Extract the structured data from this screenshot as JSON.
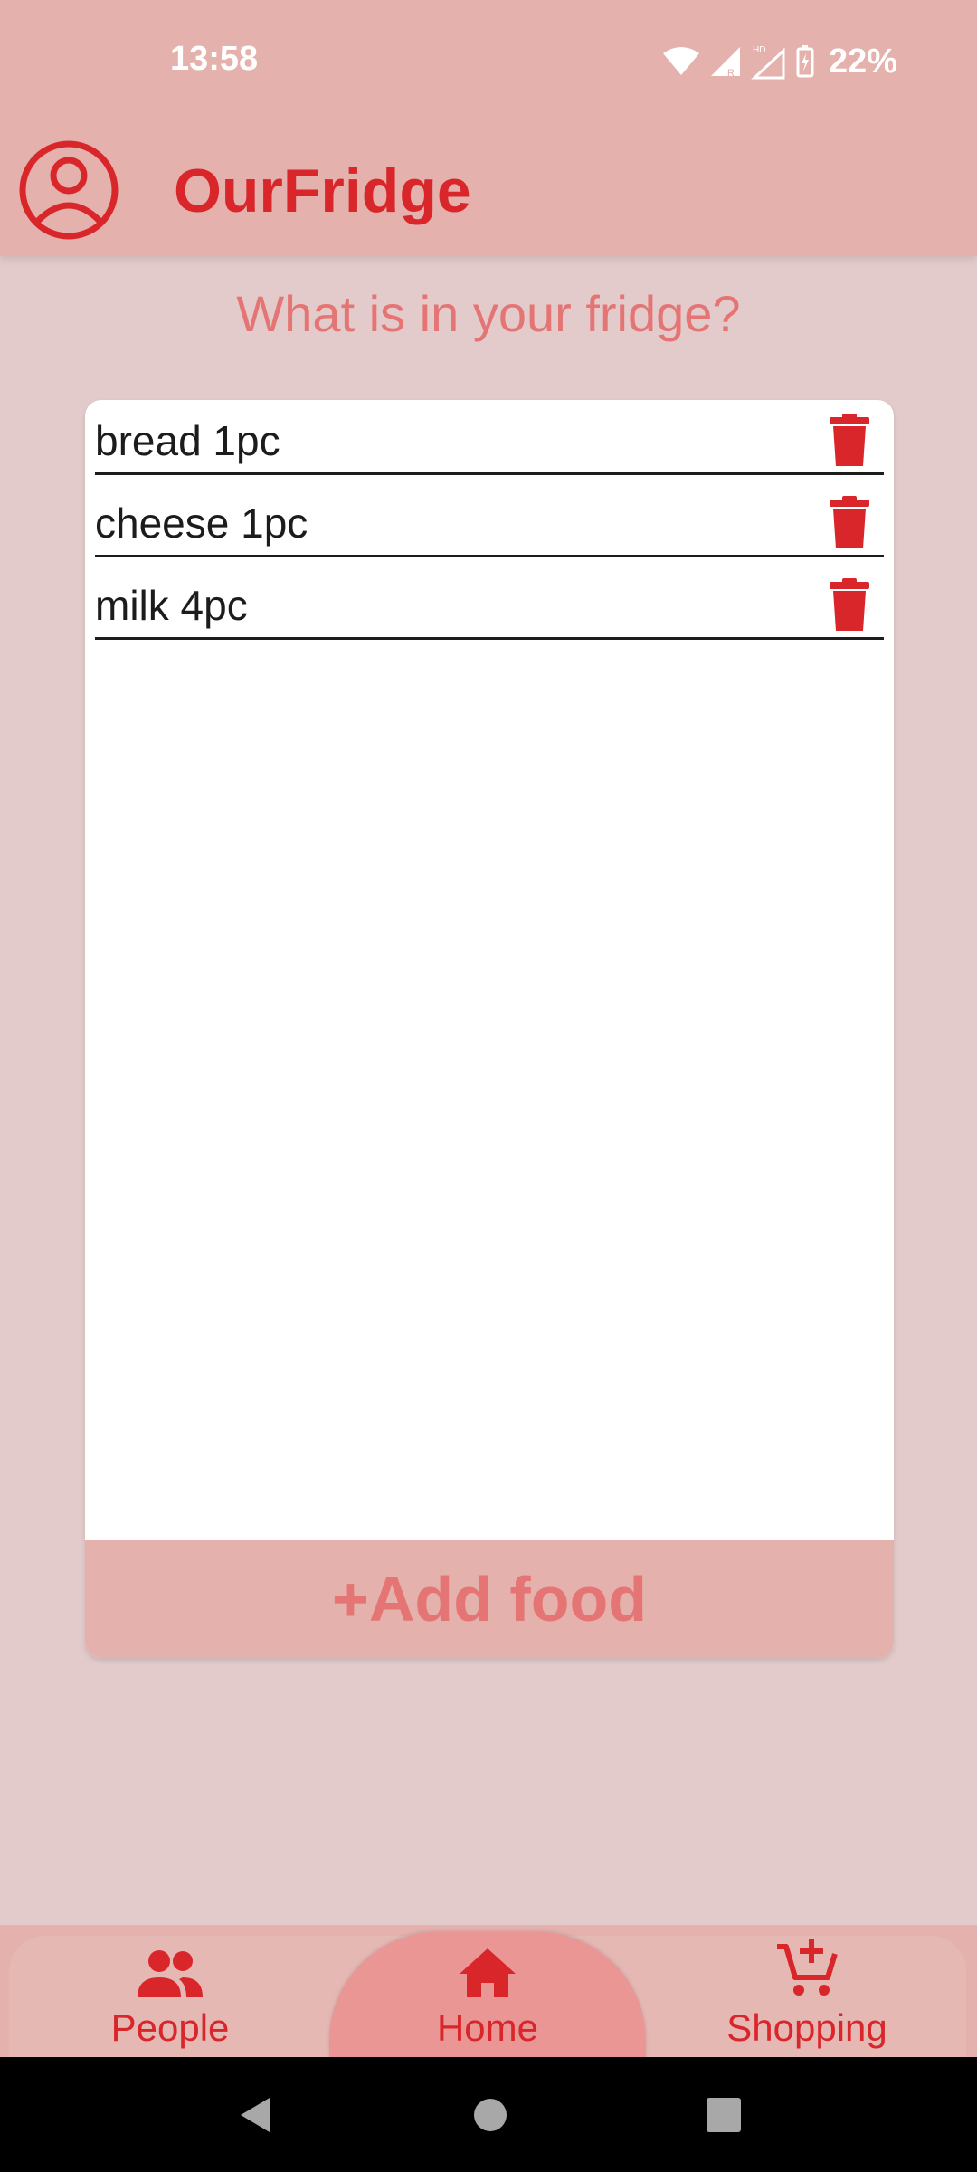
{
  "status_bar": {
    "time": "13:58",
    "battery": "22%",
    "icons": [
      "wifi-icon",
      "signal-icon",
      "signal-hd-icon",
      "battery-charging-icon"
    ]
  },
  "app_bar": {
    "title": "OurFridge",
    "profile_icon": "account-circle-icon"
  },
  "main": {
    "headline": "What is in your fridge?",
    "items": [
      {
        "label": "bread 1pc"
      },
      {
        "label": "cheese 1pc"
      },
      {
        "label": "milk 4pc"
      }
    ],
    "add_button_label": "+Add food"
  },
  "bottom_nav": {
    "items": [
      {
        "label": "People",
        "icon": "people-icon"
      },
      {
        "label": "Home",
        "icon": "home-icon",
        "selected": true
      },
      {
        "label": "Shopping",
        "icon": "cart-add-icon"
      }
    ]
  },
  "colors": {
    "accent": "#d9262b",
    "app_bar_bg": "#e4b1ad",
    "page_bg": "#e3cbcb",
    "headline": "#e47574",
    "selected_nav_bg": "#e99694"
  }
}
